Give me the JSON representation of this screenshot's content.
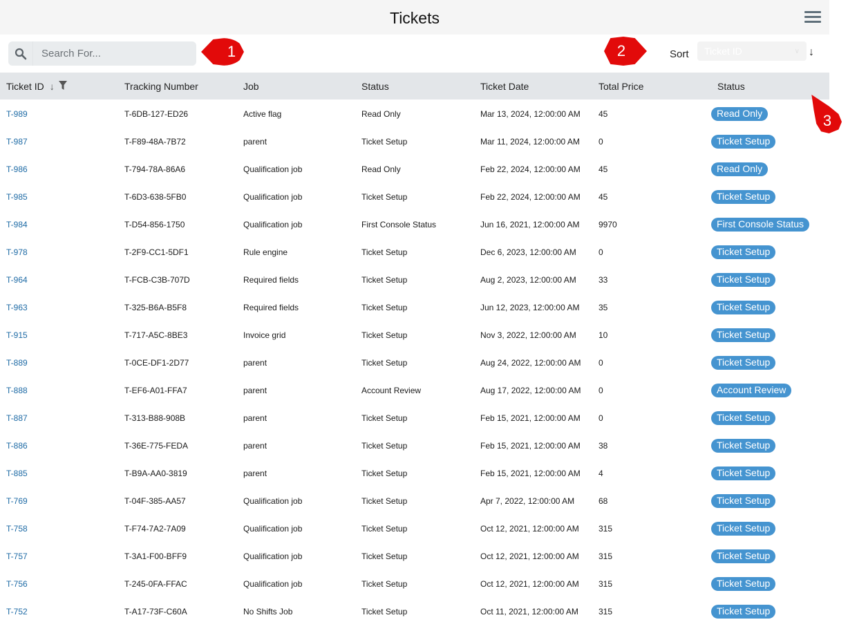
{
  "header": {
    "title": "Tickets",
    "menu_icon": "hamburger-icon"
  },
  "toolbar": {
    "search": {
      "placeholder": "Search For...",
      "value": "",
      "icon": "search-icon"
    },
    "sort": {
      "label": "Sort",
      "selected": "Ticket ID",
      "direction": "↓"
    }
  },
  "table": {
    "columns": [
      {
        "label": "Ticket ID",
        "sort": "↓",
        "filter": true
      },
      {
        "label": "Tracking Number"
      },
      {
        "label": "Job"
      },
      {
        "label": "Status"
      },
      {
        "label": "Ticket Date"
      },
      {
        "label": "Total Price"
      },
      {
        "label": "Status"
      }
    ],
    "rows": [
      {
        "id": "T-989",
        "tracking": "T-6DB-127-ED26",
        "job": "Active flag",
        "status": "Read Only",
        "date": "Mar 13, 2024, 12:00:00 AM",
        "price": "45",
        "badge": "Read Only"
      },
      {
        "id": "T-987",
        "tracking": "T-F89-48A-7B72",
        "job": "parent",
        "status": "Ticket Setup",
        "date": "Mar 11, 2024, 12:00:00 AM",
        "price": "0",
        "badge": "Ticket Setup"
      },
      {
        "id": "T-986",
        "tracking": "T-794-78A-86A6",
        "job": "Qualification job",
        "status": "Read Only",
        "date": "Feb 22, 2024, 12:00:00 AM",
        "price": "45",
        "badge": "Read Only"
      },
      {
        "id": "T-985",
        "tracking": "T-6D3-638-5FB0",
        "job": "Qualification job",
        "status": "Ticket Setup",
        "date": "Feb 22, 2024, 12:00:00 AM",
        "price": "45",
        "badge": "Ticket Setup"
      },
      {
        "id": "T-984",
        "tracking": "T-D54-856-1750",
        "job": "Qualification job",
        "status": "First Console Status",
        "date": "Jun 16, 2021, 12:00:00 AM",
        "price": "9970",
        "badge": "First Console Status"
      },
      {
        "id": "T-978",
        "tracking": "T-2F9-CC1-5DF1",
        "job": "Rule engine",
        "status": "Ticket Setup",
        "date": "Dec 6, 2023, 12:00:00 AM",
        "price": "0",
        "badge": "Ticket Setup"
      },
      {
        "id": "T-964",
        "tracking": "T-FCB-C3B-707D",
        "job": "Required fields",
        "status": "Ticket Setup",
        "date": "Aug 2, 2023, 12:00:00 AM",
        "price": "33",
        "badge": "Ticket Setup"
      },
      {
        "id": "T-963",
        "tracking": "T-325-B6A-B5F8",
        "job": "Required fields",
        "status": "Ticket Setup",
        "date": "Jun 12, 2023, 12:00:00 AM",
        "price": "35",
        "badge": "Ticket Setup"
      },
      {
        "id": "T-915",
        "tracking": "T-717-A5C-8BE3",
        "job": "Invoice grid",
        "status": "Ticket Setup",
        "date": "Nov 3, 2022, 12:00:00 AM",
        "price": "10",
        "badge": "Ticket Setup"
      },
      {
        "id": "T-889",
        "tracking": "T-0CE-DF1-2D77",
        "job": "parent",
        "status": "Ticket Setup",
        "date": "Aug 24, 2022, 12:00:00 AM",
        "price": "0",
        "badge": "Ticket Setup"
      },
      {
        "id": "T-888",
        "tracking": "T-EF6-A01-FFA7",
        "job": "parent",
        "status": "Account Review",
        "date": "Aug 17, 2022, 12:00:00 AM",
        "price": "0",
        "badge": "Account Review"
      },
      {
        "id": "T-887",
        "tracking": "T-313-B88-908B",
        "job": "parent",
        "status": "Ticket Setup",
        "date": "Feb 15, 2021, 12:00:00 AM",
        "price": "0",
        "badge": "Ticket Setup"
      },
      {
        "id": "T-886",
        "tracking": "T-36E-775-FEDA",
        "job": "parent",
        "status": "Ticket Setup",
        "date": "Feb 15, 2021, 12:00:00 AM",
        "price": "38",
        "badge": "Ticket Setup"
      },
      {
        "id": "T-885",
        "tracking": "T-B9A-AA0-3819",
        "job": "parent",
        "status": "Ticket Setup",
        "date": "Feb 15, 2021, 12:00:00 AM",
        "price": "4",
        "badge": "Ticket Setup"
      },
      {
        "id": "T-769",
        "tracking": "T-04F-385-AA57",
        "job": "Qualification job",
        "status": "Ticket Setup",
        "date": "Apr 7, 2022, 12:00:00 AM",
        "price": "68",
        "badge": "Ticket Setup"
      },
      {
        "id": "T-758",
        "tracking": "T-F74-7A2-7A09",
        "job": "Qualification job",
        "status": "Ticket Setup",
        "date": "Oct 12, 2021, 12:00:00 AM",
        "price": "315",
        "badge": "Ticket Setup"
      },
      {
        "id": "T-757",
        "tracking": "T-3A1-F00-BFF9",
        "job": "Qualification job",
        "status": "Ticket Setup",
        "date": "Oct 12, 2021, 12:00:00 AM",
        "price": "315",
        "badge": "Ticket Setup"
      },
      {
        "id": "T-756",
        "tracking": "T-245-0FA-FFAC",
        "job": "Qualification job",
        "status": "Ticket Setup",
        "date": "Oct 12, 2021, 12:00:00 AM",
        "price": "315",
        "badge": "Ticket Setup"
      },
      {
        "id": "T-752",
        "tracking": "T-A17-73F-C60A",
        "job": "No Shifts Job",
        "status": "Ticket Setup",
        "date": "Oct 11, 2021, 12:00:00 AM",
        "price": "315",
        "badge": "Ticket Setup"
      }
    ]
  },
  "annotations": [
    {
      "label": "1"
    },
    {
      "label": "2"
    },
    {
      "label": "3"
    }
  ],
  "colors": {
    "link": "#1d6aa5",
    "badge": "#4594d0",
    "header_bg": "#e3e6e9",
    "titlebar_bg": "#f5f5f5",
    "annotation": "#e20a0a"
  }
}
